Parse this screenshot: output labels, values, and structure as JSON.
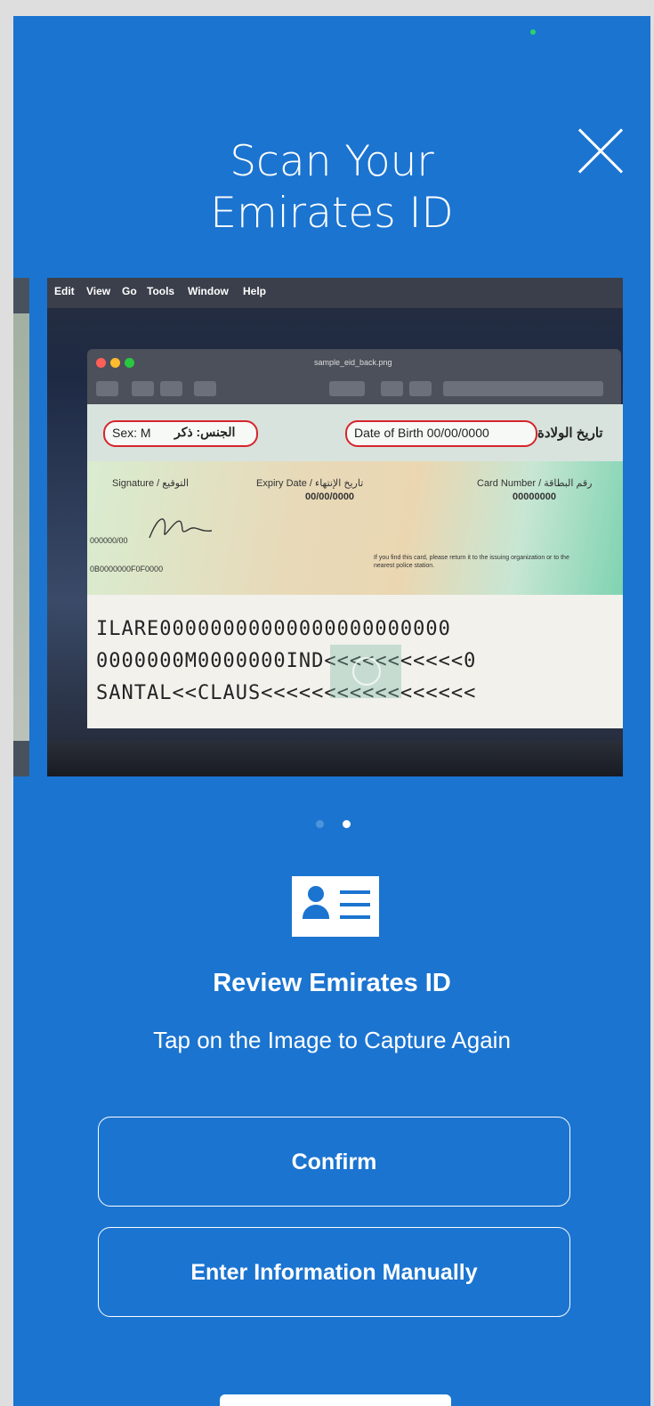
{
  "header": {
    "title_line1": "Scan Your",
    "title_line2": "Emirates ID"
  },
  "photo": {
    "menubar": [
      "Edit",
      "View",
      "Go",
      "Tools",
      "Window",
      "Help"
    ],
    "file_name": "sample_eid_back.png",
    "id_card": {
      "sex": "Sex: M",
      "sex_ar": "الجنس: ذكر",
      "dob": "Date of Birth  00/00/0000",
      "dob_ar": "تاريخ الولادة",
      "signature": "Signature / التوقيع",
      "expiry_label": "Expiry Date / تاريخ الإنتهاء",
      "expiry_value": "00/00/0000",
      "card_number_label": "Card Number / رقم البطاقة",
      "card_number_value": "00000000",
      "code1": "000000/00",
      "code2": "0B0000000F0F0000",
      "notice": "If you find this card, please return it to the issuing organization or to the nearest police station.",
      "mrz1": "ILARE00000000000000000000000",
      "mrz2": "0000000M0000000IND<<<<<<<<<<<0",
      "mrz3": "SANTAL<<CLAUS<<<<<<<<<<<<<<<<<"
    }
  },
  "pager": {
    "count": 2,
    "active": 2
  },
  "review": {
    "title": "Review Emirates ID",
    "subtitle": "Tap on the Image to Capture Again"
  },
  "buttons": {
    "confirm": "Confirm",
    "manual": "Enter Information Manually"
  },
  "colors": {
    "background": "#1b74d0",
    "text": "#ffffff"
  },
  "icons": {
    "close": "close-icon",
    "id_card": "id-card-icon"
  }
}
